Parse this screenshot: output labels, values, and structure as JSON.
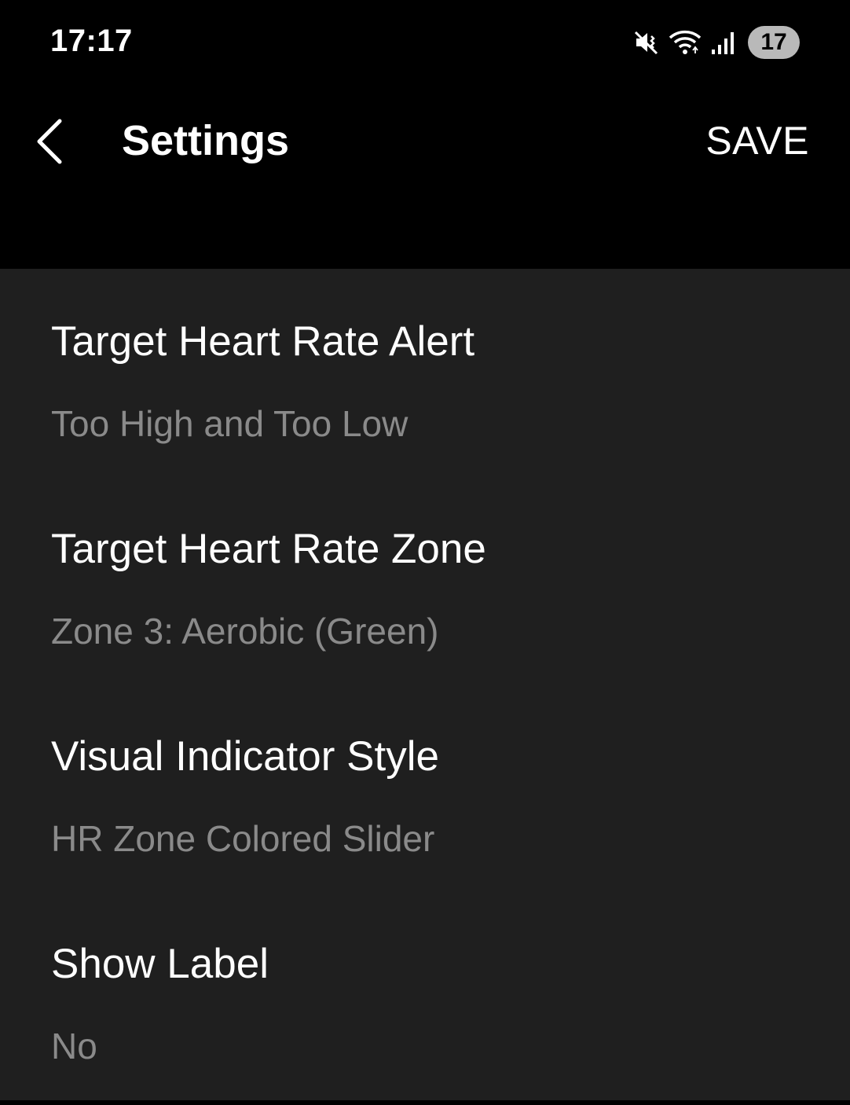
{
  "status_bar": {
    "time": "17:17",
    "battery_level": "17",
    "icons": [
      "mute-vibrate-icon",
      "wifi-icon",
      "signal-icon"
    ]
  },
  "app_bar": {
    "title": "Settings",
    "save_label": "SAVE",
    "back_icon": "chevron-left-icon"
  },
  "settings": [
    {
      "title": "Target Heart Rate Alert",
      "value": "Too High and Too Low"
    },
    {
      "title": "Target Heart Rate Zone",
      "value": "Zone 3: Aerobic (Green)"
    },
    {
      "title": "Visual Indicator Style",
      "value": "HR Zone Colored Slider"
    },
    {
      "title": "Show Label",
      "value": "No"
    }
  ],
  "colors": {
    "background": "#000000",
    "content_background": "#1f1f1f",
    "primary_text": "#ffffff",
    "secondary_text": "#8a8a8a",
    "battery_badge": "#b9b9b9"
  }
}
